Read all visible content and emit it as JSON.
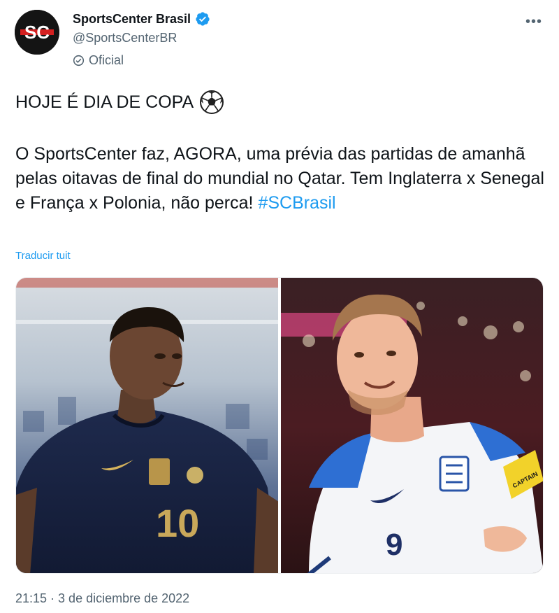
{
  "account": {
    "display_name": "SportsCenter Brasil",
    "handle": "@SportsCenterBR",
    "label": "Oficial",
    "avatar_text": "SC"
  },
  "tweet": {
    "headline": "HOJE É DIA DE COPA",
    "headline_emoji": "⚽",
    "body_main": "O SportsCenter faz, AGORA, uma prévia das partidas de amanhã pelas oitavas de final do mundial no Qatar. Tem Inglaterra x Senegal e França x Polonia, não perca! ",
    "hashtag": "#SCBrasil",
    "translate_label": "Traducir tuit",
    "timestamp": "21:15 · 3 de diciembre de 2022"
  },
  "media": {
    "left_photo": {
      "jersey_number": "10"
    },
    "right_photo": {
      "jersey_number": "9",
      "armband_text": "CAPTAIN"
    }
  },
  "colors": {
    "accent": "#1d9bf0",
    "secondary_text": "#536471",
    "primary_text": "#0f1419"
  },
  "icons": {
    "verified": "verified-badge-icon",
    "official": "official-check-icon",
    "more": "more-options-icon",
    "emoji": "soccer-ball-icon"
  }
}
